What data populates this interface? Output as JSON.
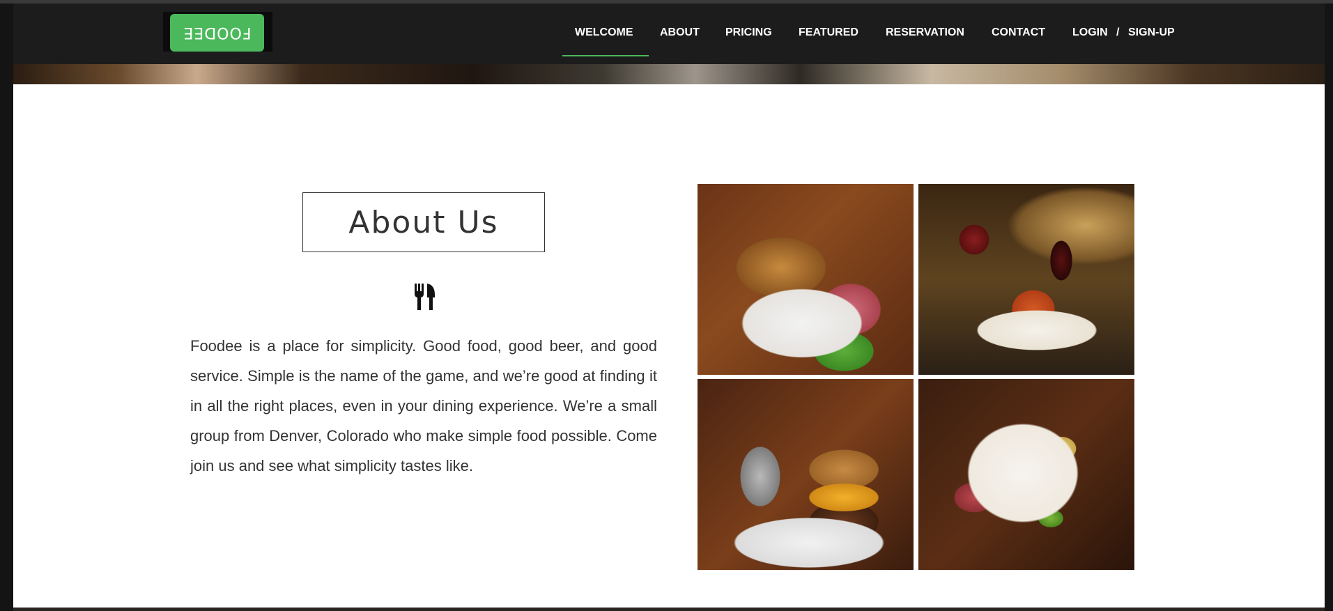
{
  "brand": {
    "logo_text": "FOODEE"
  },
  "nav": {
    "items": [
      {
        "id": "welcome",
        "label": "WELCOME",
        "active": true
      },
      {
        "id": "about",
        "label": "ABOUT"
      },
      {
        "id": "pricing",
        "label": "PRICING"
      },
      {
        "id": "featured",
        "label": "FEATURED"
      },
      {
        "id": "reservation",
        "label": "RESERVATION"
      },
      {
        "id": "contact",
        "label": "CONTACT"
      }
    ],
    "login_label": "LOGIN",
    "separator": "/",
    "signup_label": "SIGN-UP"
  },
  "about": {
    "title": "About Us",
    "icon": "fork-knife-icon",
    "body": "Foodee is a place for simplicity. Good food, good beer, and good service. Simple is the name of the game, and we’re good at finding it in all the right places, even in your dining experience. We’re a small group from Denver, Colorado who make simple food possible. Come join us and see what simplicity tastes like."
  },
  "gallery": {
    "photos": [
      {
        "name": "fries-and-pastrami-photo"
      },
      {
        "name": "wine-and-fish-photo"
      },
      {
        "name": "burger-and-fries-photo"
      },
      {
        "name": "antipasto-platter-photo"
      }
    ]
  },
  "colors": {
    "accent": "#4cb85c",
    "navbar_bg": "#1c1c1c",
    "text": "#333333"
  }
}
